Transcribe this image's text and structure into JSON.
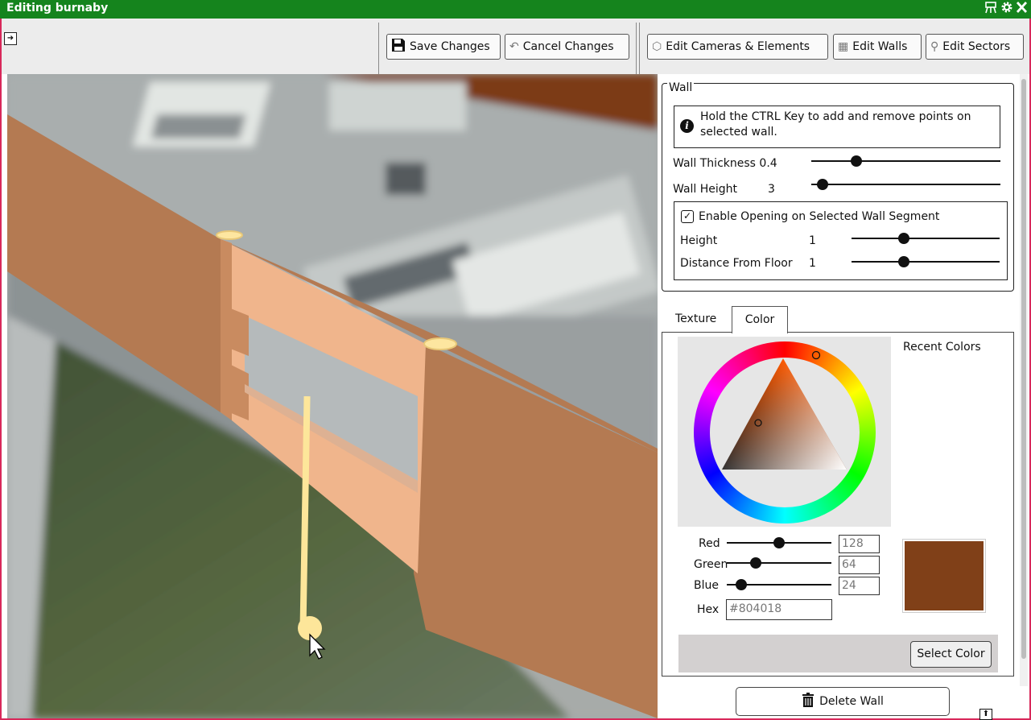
{
  "window": {
    "title": "Editing burnaby",
    "title_icons": [
      "layout-icon",
      "gear-icon",
      "close-icon"
    ]
  },
  "toolbar": {
    "save_label": "Save Changes",
    "cancel_label": "Cancel Changes",
    "edit_cameras_label": "Edit Cameras & Elements",
    "edit_walls_label": "Edit Walls",
    "edit_sectors_label": "Edit Sectors"
  },
  "wall_panel": {
    "legend": "Wall",
    "info_text": "Hold the CTRL Key to add and remove points on selected wall.",
    "thickness_label": "Wall Thickness",
    "thickness_value": "0.4",
    "thickness_fraction": 0.22,
    "height_label": "Wall Height",
    "height_value": "3",
    "height_fraction": 0.03,
    "opening": {
      "enabled": true,
      "checkbox_label": "Enable Opening on Selected Wall Segment",
      "height_label": "Height",
      "height_value": "1",
      "height_fraction": 0.34,
      "distance_label": "Distance From Floor",
      "distance_value": "1",
      "distance_fraction": 0.34
    }
  },
  "color_panel": {
    "tabs": [
      {
        "label": "Texture",
        "active": false
      },
      {
        "label": "Color",
        "active": true
      }
    ],
    "recent_colors_label": "Recent Colors",
    "red_label": "Red",
    "red_value": "128",
    "green_label": "Green",
    "green_value": "64",
    "blue_label": "Blue",
    "blue_value": "24",
    "hex_label": "Hex",
    "hex_value": "#804018",
    "preview_color": "#804018",
    "select_label": "Select Color"
  },
  "delete_label": "Delete Wall",
  "colors": {
    "titlebar": "#15841d",
    "frame": "#d8285a",
    "wall_dark": "#b47a52",
    "wall_light": "#f0b58c",
    "marker": "#fde6a0"
  }
}
